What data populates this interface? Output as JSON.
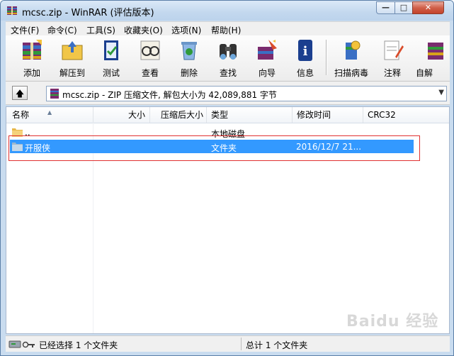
{
  "window": {
    "title": "mcsc.zip - WinRAR (评估版本)"
  },
  "controls": {
    "minimize": "—",
    "maximize": "□",
    "close": "✕"
  },
  "menu": [
    "文件(F)",
    "命令(C)",
    "工具(S)",
    "收藏夹(O)",
    "选项(N)",
    "帮助(H)"
  ],
  "toolbar": [
    "添加",
    "解压到",
    "测试",
    "查看",
    "删除",
    "查找",
    "向导",
    "信息",
    "扫描病毒",
    "注释",
    "自解"
  ],
  "address": {
    "up": "🡅",
    "path": "mcsc.zip - ZIP 压缩文件, 解包大小为 42,089,881 字节",
    "dropdown": "▼"
  },
  "columns": [
    "名称",
    "大小",
    "压缩后大小",
    "类型",
    "修改时间",
    "CRC32"
  ],
  "rows": [
    {
      "name": "..",
      "size": "",
      "packed": "",
      "type": "本地磁盘",
      "modified": "",
      "crc": ""
    },
    {
      "name": "开服侠",
      "size": "",
      "packed": "",
      "type": "文件夹",
      "modified": "2016/12/7 21...",
      "crc": ""
    }
  ],
  "status": {
    "left": "已经选择 1 个文件夹",
    "right": "总计 1 个文件夹"
  },
  "watermark": "Baidu 经验",
  "colors": {
    "selection": "#3399ff",
    "highlight_box": "#e03030",
    "titlebar": "#c3d8ee"
  }
}
